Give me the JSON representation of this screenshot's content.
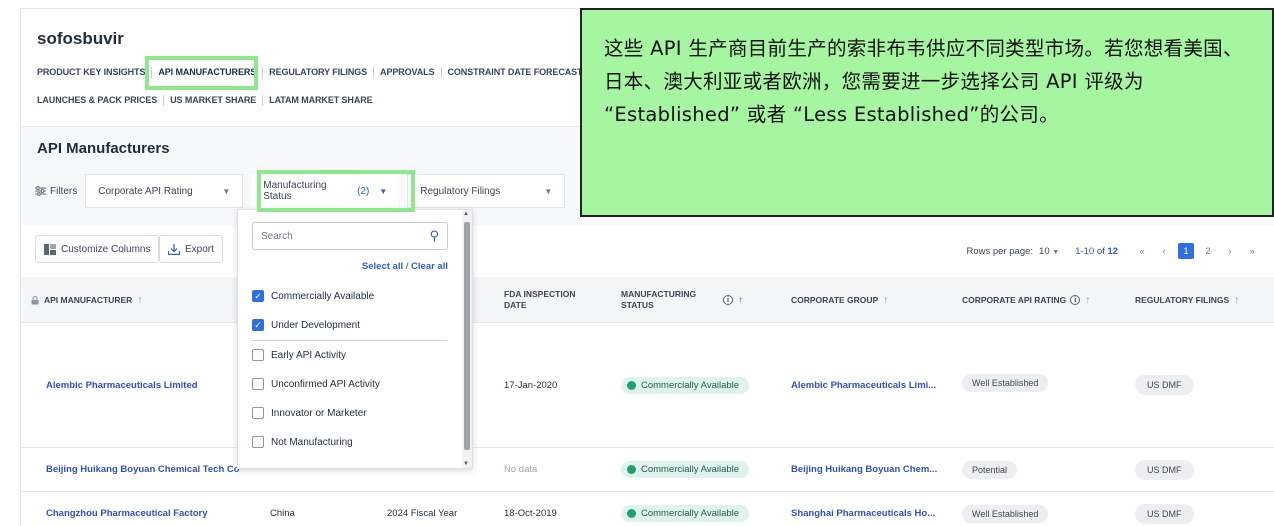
{
  "app": {
    "title": "sofosbuvir"
  },
  "nav": {
    "row1": [
      "PRODUCT KEY INSIGHTS",
      "API MANUFACTURERS",
      "REGULATORY FILINGS",
      "APPROVALS",
      "CONSTRAINT DATE FORECAST &"
    ],
    "row2": [
      "LAUNCHES & PACK PRICES",
      "US MARKET SHARE",
      "LATAM MARKET SHARE"
    ]
  },
  "section": {
    "title": "API Manufacturers"
  },
  "filters": {
    "label": "Filters",
    "corporate_api_rating": "Corporate API Rating",
    "manufacturing_status": "Manufacturing Status",
    "manufacturing_status_count": "(2)",
    "regulatory_filings": "Regulatory Filings"
  },
  "toolbar": {
    "customize_columns": "Customize Columns",
    "export": "Export",
    "rows_per_page_label": "Rows per page:",
    "rows_per_page_value": "10",
    "range": "1-10",
    "of": "of",
    "total": "12",
    "pages": [
      "1",
      "2"
    ]
  },
  "table": {
    "headers": {
      "api_manufacturer": "API MANUFACTURER",
      "fda_inspection_date": "FDA INSPECTION DATE",
      "manufacturing_status": "MANUFACTURING STATUS",
      "corporate_group": "CORPORATE GROUP",
      "corporate_api_rating": "CORPORATE API RATING",
      "regulatory_filings": "REGULATORY FILINGS"
    },
    "rows": [
      {
        "manufacturer": "Alembic Pharmaceuticals Limited",
        "country": "",
        "fiscal": "",
        "fda_date": "17-Jan-2020",
        "status": "Commercially Available",
        "group": "Alembic Pharmaceuticals Limi...",
        "rating": "Well Established",
        "filings": "US DMF"
      },
      {
        "manufacturer": "Beijing Huikang Boyuan Chemical Tech Co",
        "country": "",
        "fiscal": "",
        "fda_date": "No data",
        "status": "Commercially Available",
        "group": "Beijing Huikang Boyuan Chem...",
        "rating": "Potential",
        "filings": "US DMF"
      },
      {
        "manufacturer": "Changzhou Pharmaceutical Factory",
        "country": "China",
        "fiscal": "2024 Fiscal Year",
        "fda_date": "18-Oct-2019",
        "status": "Commercially Available",
        "group": "Shanghai Pharmaceuticals Ho...",
        "rating": "Well Established",
        "filings": "US DMF"
      }
    ]
  },
  "dropdown": {
    "search_placeholder": "Search",
    "select_all": "Select all",
    "clear_all": "Clear all",
    "options": [
      {
        "label": "Commercially Available",
        "checked": true
      },
      {
        "label": "Under Development",
        "checked": true
      },
      {
        "label": "Early API Activity",
        "checked": false
      },
      {
        "label": "Unconfirmed API Activity",
        "checked": false
      },
      {
        "label": "Innovator or Marketer",
        "checked": false
      },
      {
        "label": "Not Manufacturing",
        "checked": false
      }
    ]
  },
  "callout": {
    "text": "这些 API 生产商目前生产的索非布韦供应不同类型市场。若您想看美国、日本、澳大利亚或者欧洲，您需要进一步选择公司 API 评级为 “Established” 或者 “Less Established”的公司。"
  },
  "colors": {
    "highlight": "#8ee88c",
    "callout_bg": "#a6f5a0",
    "link": "#2f4fc4",
    "accent": "#2f6fe0"
  }
}
